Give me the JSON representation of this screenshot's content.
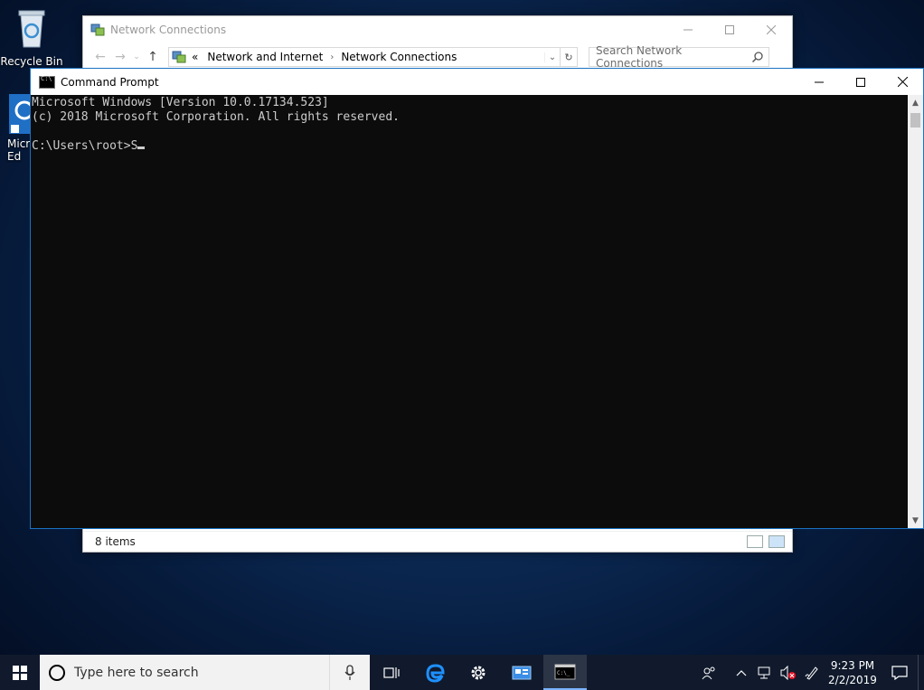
{
  "desktop": {
    "icons": [
      {
        "label": "Recycle Bin"
      },
      {
        "label": "Micr\nEd"
      }
    ]
  },
  "explorer": {
    "title": "Network Connections",
    "breadcrumb": [
      "«",
      "Network and Internet",
      "Network Connections"
    ],
    "search_placeholder": "Search Network Connections",
    "status": "8 items"
  },
  "cmd": {
    "title": "Command Prompt",
    "lines": [
      "Microsoft Windows [Version 10.0.17134.523]",
      "(c) 2018 Microsoft Corporation. All rights reserved.",
      "",
      "C:\\Users\\root>S"
    ]
  },
  "taskbar": {
    "search_placeholder": "Type here to search",
    "clock_time": "9:23 PM",
    "clock_date": "2/2/2019"
  }
}
